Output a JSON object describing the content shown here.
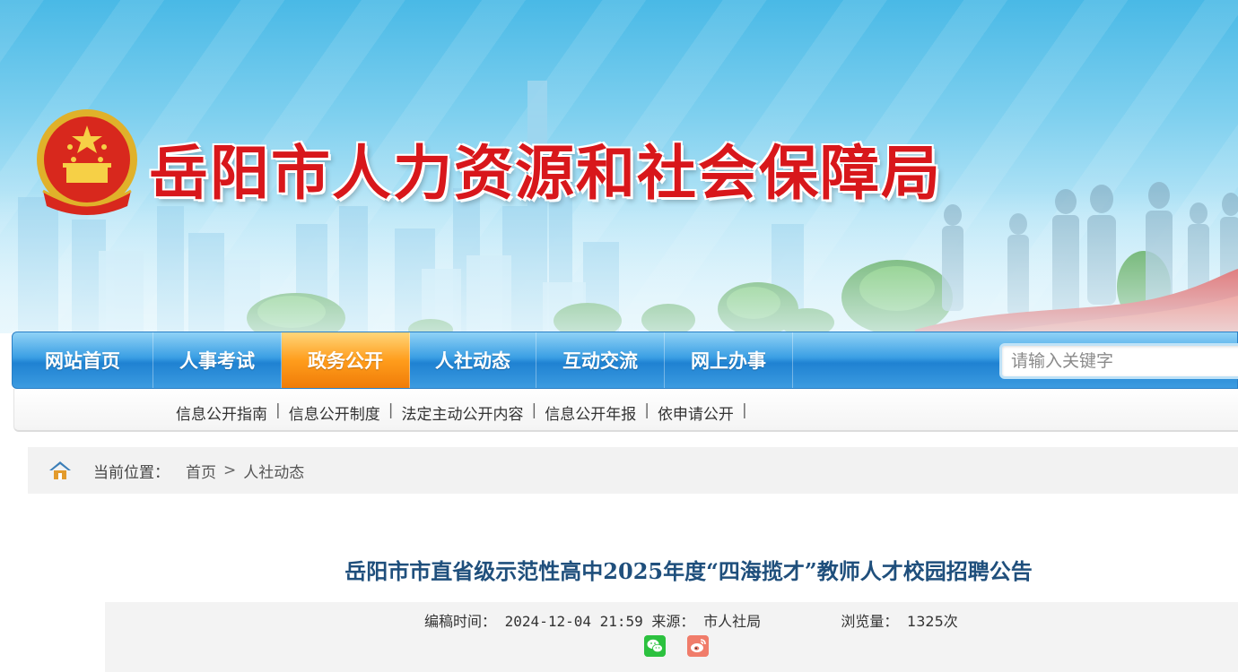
{
  "header": {
    "site_title": "岳阳市人力资源和社会保障局",
    "title_color": "#d8171b"
  },
  "nav": {
    "items": [
      {
        "label": "网站首页",
        "active": false
      },
      {
        "label": "人事考试",
        "active": false
      },
      {
        "label": "政务公开",
        "active": true
      },
      {
        "label": "人社动态",
        "active": false
      },
      {
        "label": "互动交流",
        "active": false
      },
      {
        "label": "网上办事",
        "active": false
      }
    ],
    "search_placeholder": "请输入关键字",
    "accent_color": "#2a8ad8",
    "active_color": "#f5900f"
  },
  "subnav": {
    "items": [
      "信息公开指南",
      "信息公开制度",
      "法定主动公开内容",
      "信息公开年报",
      "依申请公开"
    ],
    "separator": "|"
  },
  "breadcrumb": {
    "label": "当前位置：",
    "items": [
      "首页",
      "人社动态"
    ],
    "arrow": ">"
  },
  "article": {
    "title": "岳阳市市直省级示范性高中2025年度“四海揽才”教师人才校园招聘公告",
    "meta": {
      "time_label": "编稿时间：",
      "time_value": "2024-12-04 21:59",
      "source_label": "来源：",
      "source_value": "市人社局",
      "views_label": "浏览量：",
      "views_value": "1325次"
    },
    "share_icons": [
      "wechat-icon",
      "weibo-icon"
    ]
  }
}
